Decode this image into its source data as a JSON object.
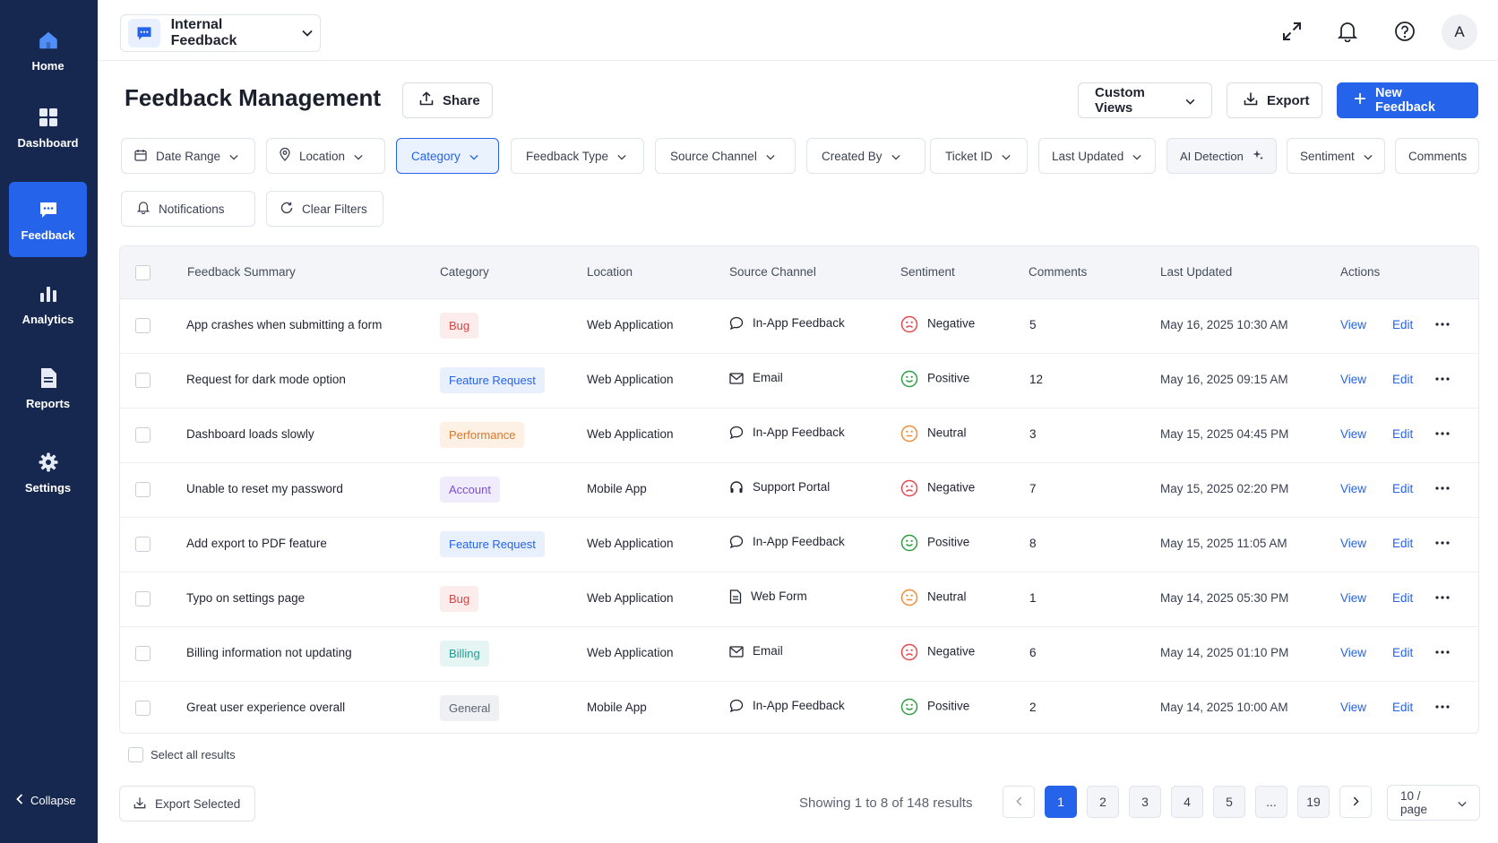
{
  "sidebar": {
    "items": [
      {
        "label": "Home",
        "icon": "home-icon"
      },
      {
        "label": "Dashboard",
        "icon": "grid-icon"
      },
      {
        "label": "Feedback",
        "icon": "chat-icon",
        "active": true
      },
      {
        "label": "Analytics",
        "icon": "bar-chart-icon"
      },
      {
        "label": "Reports",
        "icon": "document-icon"
      },
      {
        "label": "Settings",
        "icon": "gear-icon"
      }
    ],
    "collapse_label": "Collapse"
  },
  "header": {
    "workspace": "Internal Feedback",
    "avatar_initial": "A"
  },
  "page": {
    "title": "Feedback Management",
    "share_label": "Share",
    "custom_views_label": "Custom Views",
    "export_label": "Export",
    "new_feedback_label": "New Feedback"
  },
  "filters": {
    "date_range": "Date Range",
    "location": "Location",
    "category": "Category",
    "feedback_type": "Feedback Type",
    "source_channel": "Source Channel",
    "created_by": "Created By",
    "ticket_id": "Ticket ID",
    "last_updated": "Last Updated",
    "ai_detection": "AI Detection",
    "sentiment": "Sentiment",
    "comments": "Comments",
    "notifications": "Notifications",
    "clear_filters": "Clear Filters"
  },
  "table": {
    "columns": [
      "Feedback Summary",
      "Category",
      "Location",
      "Source Channel",
      "Sentiment",
      "Comments",
      "Last Updated",
      "Actions"
    ],
    "view_label": "View",
    "edit_label": "Edit",
    "rows": [
      {
        "summary": "App crashes when submitting a form",
        "category": "Bug",
        "location": "Web Application",
        "channel": "In-App Feedback",
        "channel_icon": "chat-bubble-icon",
        "sentiment": "Negative",
        "comments": "5",
        "updated": "May 16, 2025 10:30 AM"
      },
      {
        "summary": "Request for dark mode option",
        "category": "Feature Request",
        "location": "Web Application",
        "channel": "Email",
        "channel_icon": "mail-icon",
        "sentiment": "Positive",
        "comments": "12",
        "updated": "May 16, 2025 09:15 AM"
      },
      {
        "summary": "Dashboard loads slowly",
        "category": "Performance",
        "location": "Web Application",
        "channel": "In-App Feedback",
        "channel_icon": "chat-bubble-icon",
        "sentiment": "Neutral",
        "comments": "3",
        "updated": "May 15, 2025 04:45 PM"
      },
      {
        "summary": "Unable to reset my password",
        "category": "Account",
        "location": "Mobile App",
        "channel": "Support Portal",
        "channel_icon": "headset-icon",
        "sentiment": "Negative",
        "comments": "7",
        "updated": "May 15, 2025 02:20 PM"
      },
      {
        "summary": "Add export to PDF feature",
        "category": "Feature Request",
        "location": "Web Application",
        "channel": "In-App Feedback",
        "channel_icon": "chat-bubble-icon",
        "sentiment": "Positive",
        "comments": "8",
        "updated": "May 15, 2025 11:05 AM"
      },
      {
        "summary": "Typo on settings page",
        "category": "Bug",
        "location": "Web Application",
        "channel": "Web Form",
        "channel_icon": "form-icon",
        "sentiment": "Neutral",
        "comments": "1",
        "updated": "May 14, 2025 05:30 PM"
      },
      {
        "summary": "Billing information not updating",
        "category": "Billing",
        "location": "Web Application",
        "channel": "Email",
        "channel_icon": "mail-icon",
        "sentiment": "Negative",
        "comments": "6",
        "updated": "May 14, 2025 01:10 PM"
      },
      {
        "summary": "Great user experience overall",
        "category": "General",
        "location": "Mobile App",
        "channel": "In-App Feedback",
        "channel_icon": "chat-bubble-icon",
        "sentiment": "Positive",
        "comments": "2",
        "updated": "May 14, 2025 10:00 AM"
      }
    ]
  },
  "footer": {
    "select_all": "Select all results",
    "export_selected": "Export Selected",
    "showing": "Showing 1 to 8 of 148 results",
    "pages": [
      "1",
      "2",
      "3",
      "4",
      "5",
      "...",
      "19"
    ],
    "page_size": "10 / page"
  },
  "colors": {
    "sidebar_bg": "#16284f",
    "accent": "#2563eb",
    "negative": "#e5484d",
    "positive": "#2f9e44",
    "neutral": "#f08c3a"
  }
}
